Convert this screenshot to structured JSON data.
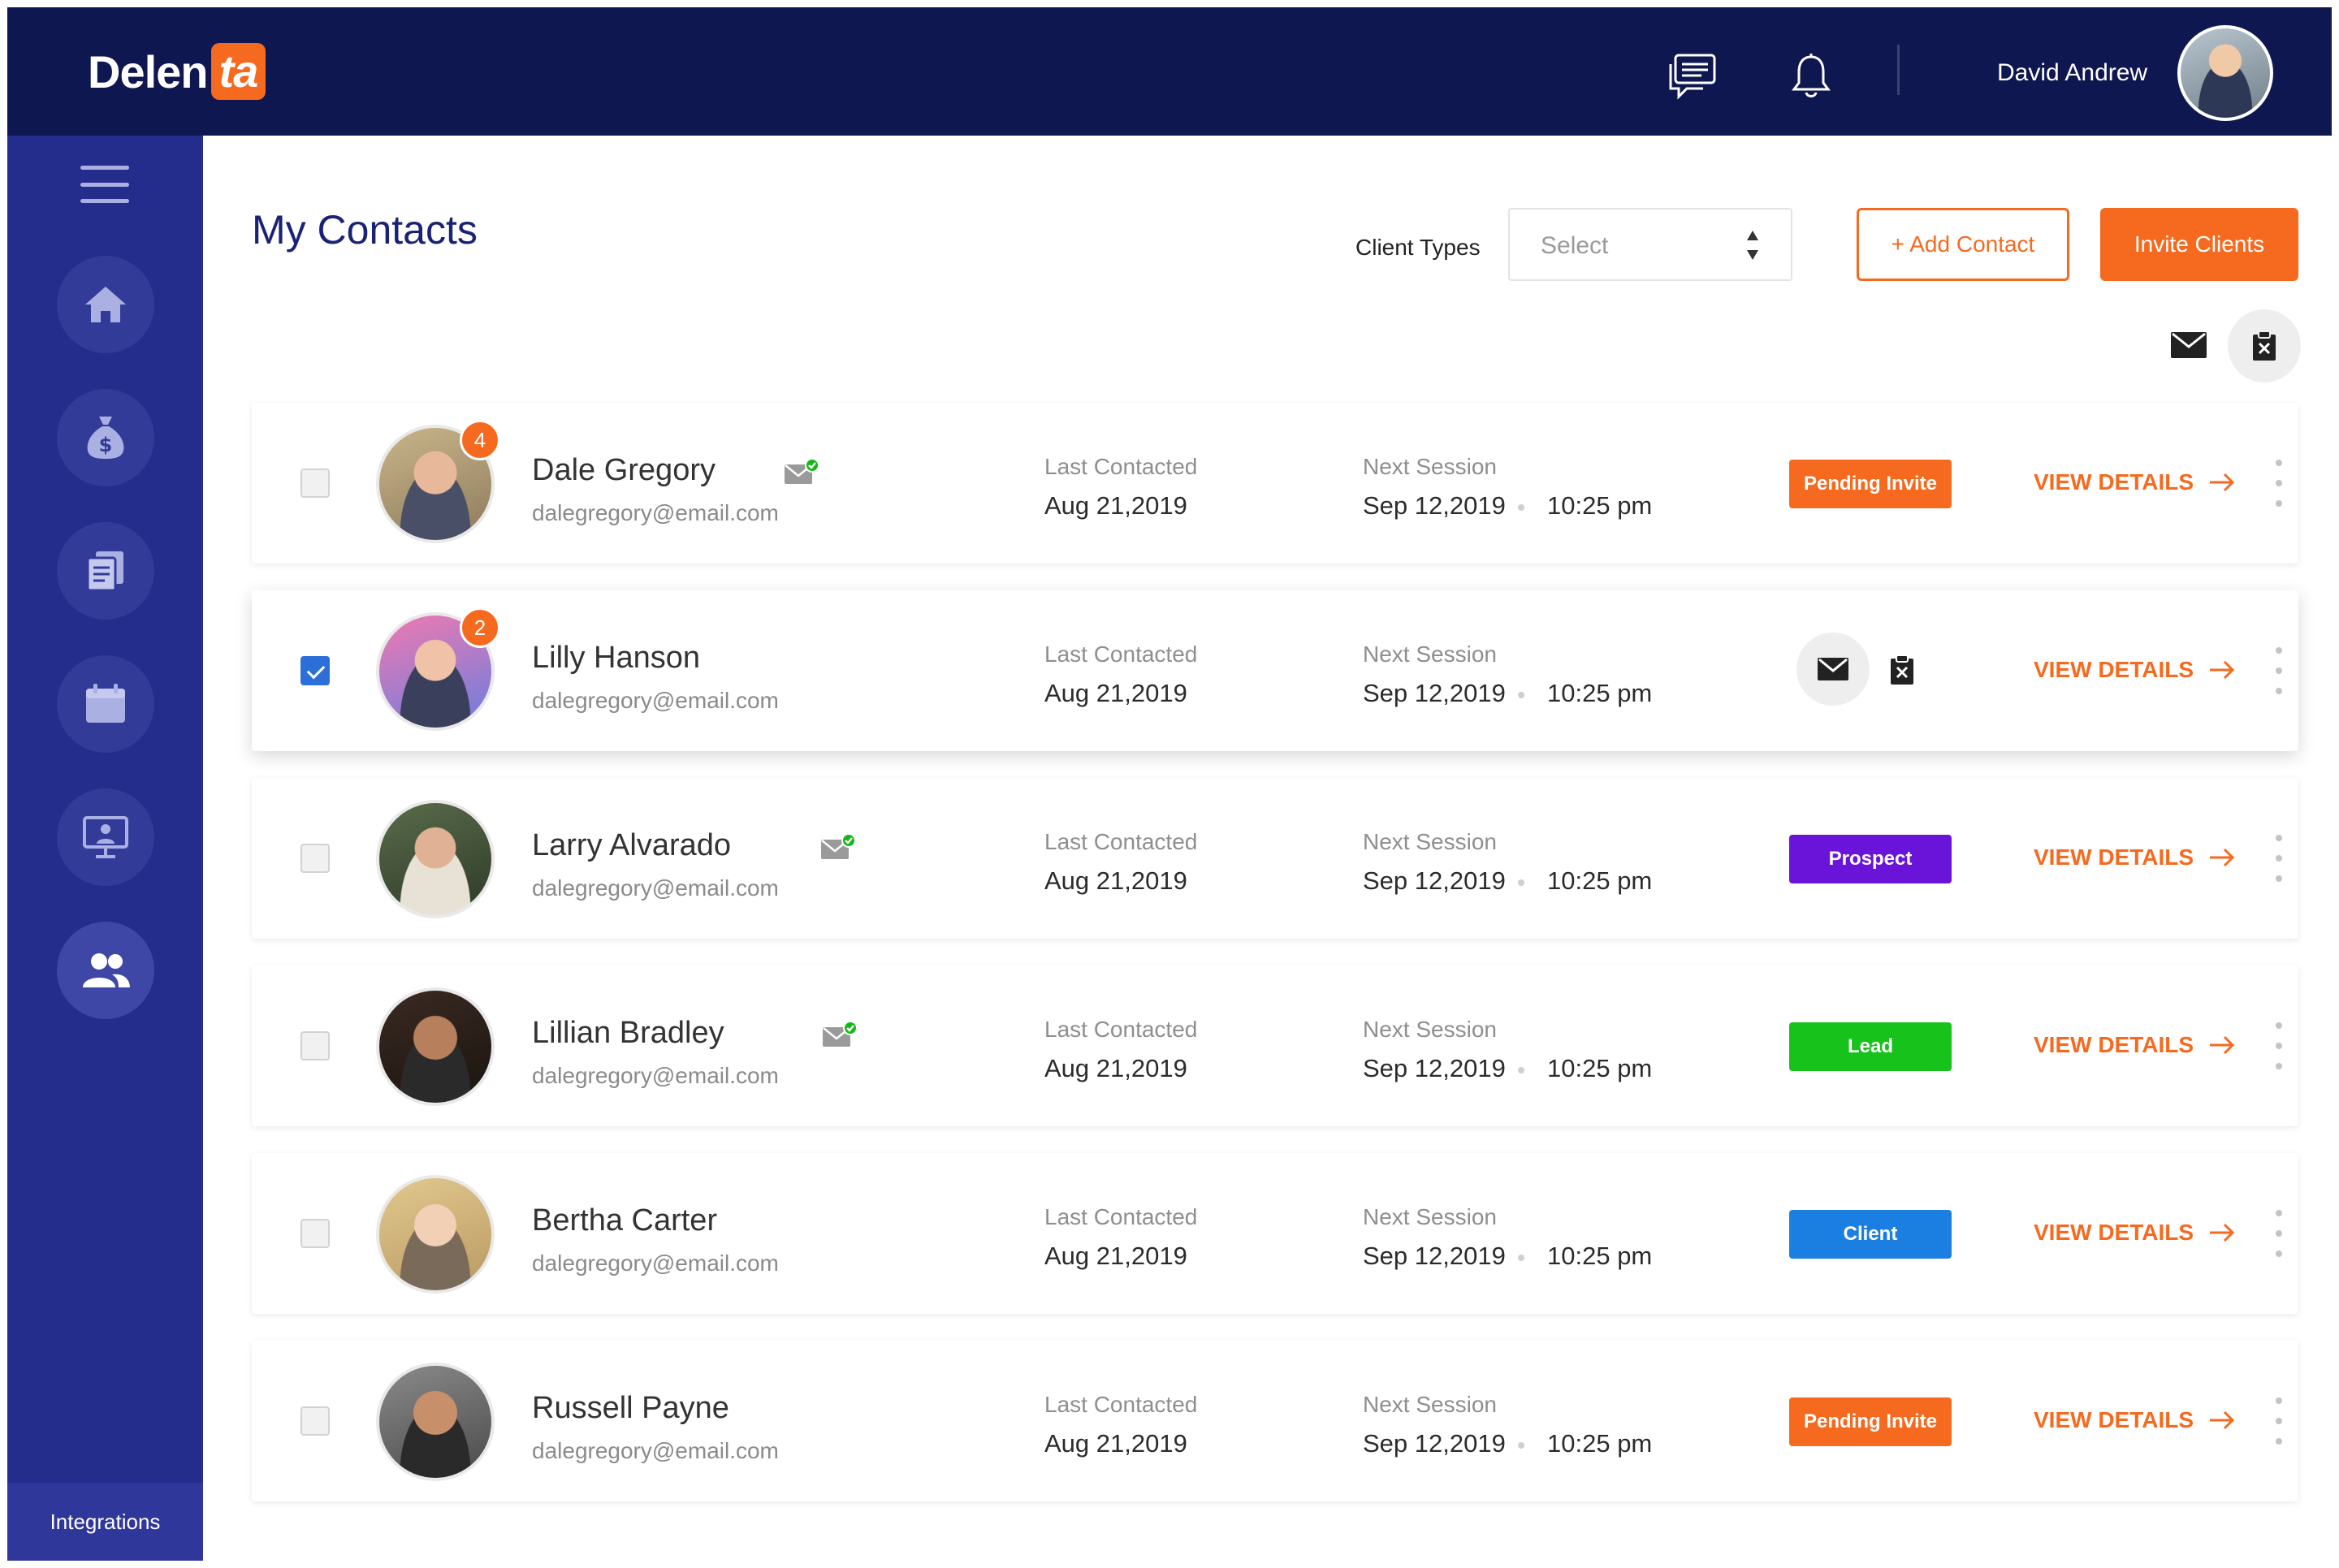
{
  "brand": {
    "logo_text_a": "Delen",
    "logo_text_b": "ta",
    "accent": "#f66a1f",
    "nav_bg": "#0f1750",
    "sidebar_bg": "#252d8c"
  },
  "header": {
    "icons": [
      "chat-icon",
      "bell-icon"
    ],
    "user_name": "David Andrew"
  },
  "sidebar": {
    "items": [
      {
        "id": "home",
        "icon": "home-icon"
      },
      {
        "id": "money",
        "icon": "money-bag-icon"
      },
      {
        "id": "documents",
        "icon": "documents-icon"
      },
      {
        "id": "calendar",
        "icon": "calendar-icon"
      },
      {
        "id": "sessions",
        "icon": "presentation-icon"
      },
      {
        "id": "contacts",
        "icon": "contacts-icon",
        "active": true
      }
    ],
    "footer_label": "Integrations"
  },
  "main": {
    "title": "My Contacts",
    "filter_label": "Client Types",
    "select_placeholder": "Select",
    "add_contact_label": "+ Add Contact",
    "invite_clients_label": "Invite Clients"
  },
  "labels": {
    "last_contacted": "Last Contacted",
    "next_session": "Next Session",
    "view_details": "VIEW DETAILS"
  },
  "contacts": [
    {
      "name": "Dale Gregory",
      "email": "dalegregory@email.com",
      "last_contacted": "Aug 21,2019",
      "next_date": "Sep 12,2019",
      "next_time": "10:25 pm",
      "status": "Pending Invite",
      "status_color": "#f66a1f",
      "badge": "4",
      "verified_mail": true,
      "selected": false
    },
    {
      "name": "Lilly Hanson",
      "email": "dalegregory@email.com",
      "last_contacted": "Aug 21,2019",
      "next_date": "Sep 12,2019",
      "next_time": "10:25 pm",
      "status": "",
      "status_color": "",
      "badge": "2",
      "verified_mail": false,
      "selected": true
    },
    {
      "name": "Larry Alvarado",
      "email": "dalegregory@email.com",
      "last_contacted": "Aug 21,2019",
      "next_date": "Sep 12,2019",
      "next_time": "10:25 pm",
      "status": "Prospect",
      "status_color": "#6b14d9",
      "badge": "",
      "verified_mail": true,
      "selected": false
    },
    {
      "name": "Lillian Bradley",
      "email": "dalegregory@email.com",
      "last_contacted": "Aug 21,2019",
      "next_date": "Sep 12,2019",
      "next_time": "10:25 pm",
      "status": "Lead",
      "status_color": "#17c21a",
      "badge": "",
      "verified_mail": true,
      "selected": false
    },
    {
      "name": "Bertha Carter",
      "email": "dalegregory@email.com",
      "last_contacted": "Aug 21,2019",
      "next_date": "Sep 12,2019",
      "next_time": "10:25 pm",
      "status": "Client",
      "status_color": "#1a7fe0",
      "badge": "",
      "verified_mail": false,
      "selected": false
    },
    {
      "name": "Russell Payne",
      "email": "dalegregory@email.com",
      "last_contacted": "Aug 21,2019",
      "next_date": "Sep 12,2019",
      "next_time": "10:25 pm",
      "status": "Pending Invite",
      "status_color": "#f66a1f",
      "badge": "",
      "verified_mail": false,
      "selected": false
    }
  ]
}
